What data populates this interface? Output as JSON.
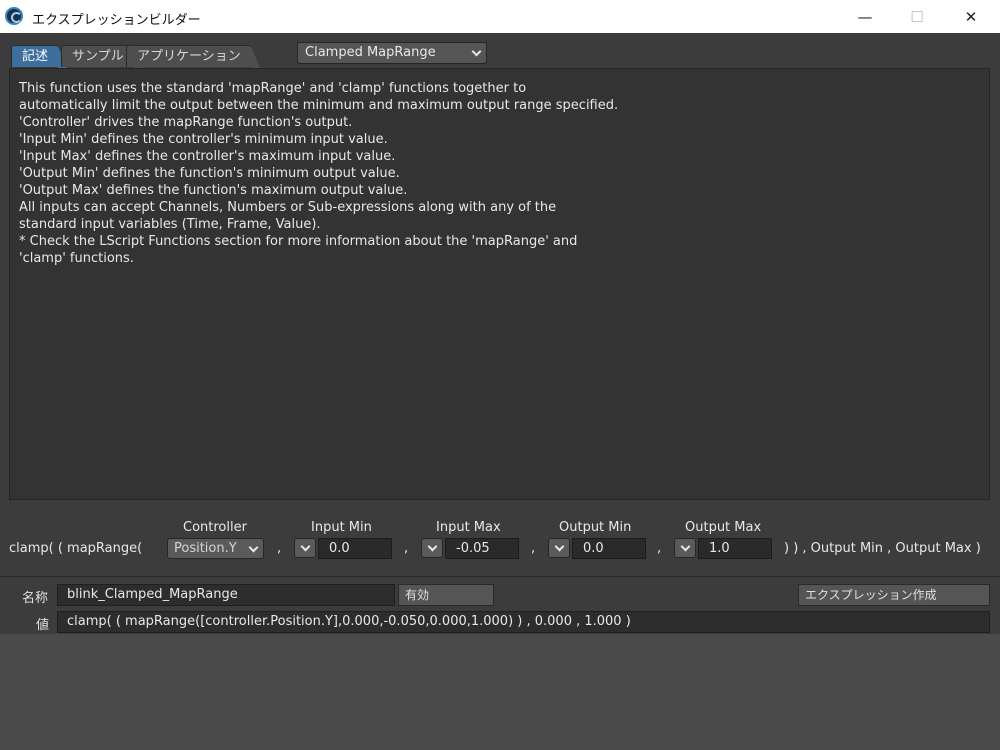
{
  "window": {
    "title": "エクスプレッションビルダー",
    "minimize_glyph": "—",
    "maximize_glyph": "☐",
    "close_glyph": "✕"
  },
  "tabs": [
    {
      "label": "記述",
      "active": true
    },
    {
      "label": "サンプル",
      "active": false
    },
    {
      "label": "アプリケーション",
      "active": false
    }
  ],
  "preset": {
    "selected": "Clamped MapRange"
  },
  "description": {
    "lines": [
      "This function uses the standard 'mapRange' and 'clamp' functions together to",
      "automatically limit the output between the minimum and maximum output range specified.",
      "",
      "'Controller' drives the mapRange function's output.",
      "'Input Min' defines the controller's minimum input value.",
      "'Input Max' defines the controller's maximum input value.",
      "'Output Min' defines the function's minimum output value.",
      "'Output Max' defines the function's maximum output value.",
      "",
      "All inputs can accept Channels, Numbers or Sub-expressions along with any of the",
      "standard input variables (Time, Frame, Value).",
      "",
      "* Check the LScript Functions section for more information about the 'mapRange' and",
      "'clamp' functions."
    ]
  },
  "builder": {
    "prefix": "clamp( ( mapRange(",
    "separator": ",",
    "suffix": ") ) , Output Min , Output Max )",
    "controller": {
      "label": "Controller",
      "value": "Position.Y"
    },
    "input_min": {
      "label": "Input Min",
      "value": "0.0"
    },
    "input_max": {
      "label": "Input Max",
      "value": "-0.05"
    },
    "output_min": {
      "label": "Output Min",
      "value": "0.0"
    },
    "output_max": {
      "label": "Output Max",
      "value": "1.0"
    }
  },
  "bottom": {
    "name_label": "名称",
    "name_value": "blink_Clamped_MapRange",
    "enabled_button": "有効",
    "create_button": "エクスプレッション作成",
    "value_label": "値",
    "value_text": "clamp( ( mapRange([controller.Position.Y],0.000,-0.050,0.000,1.000) ) , 0.000 , 1.000 )"
  }
}
